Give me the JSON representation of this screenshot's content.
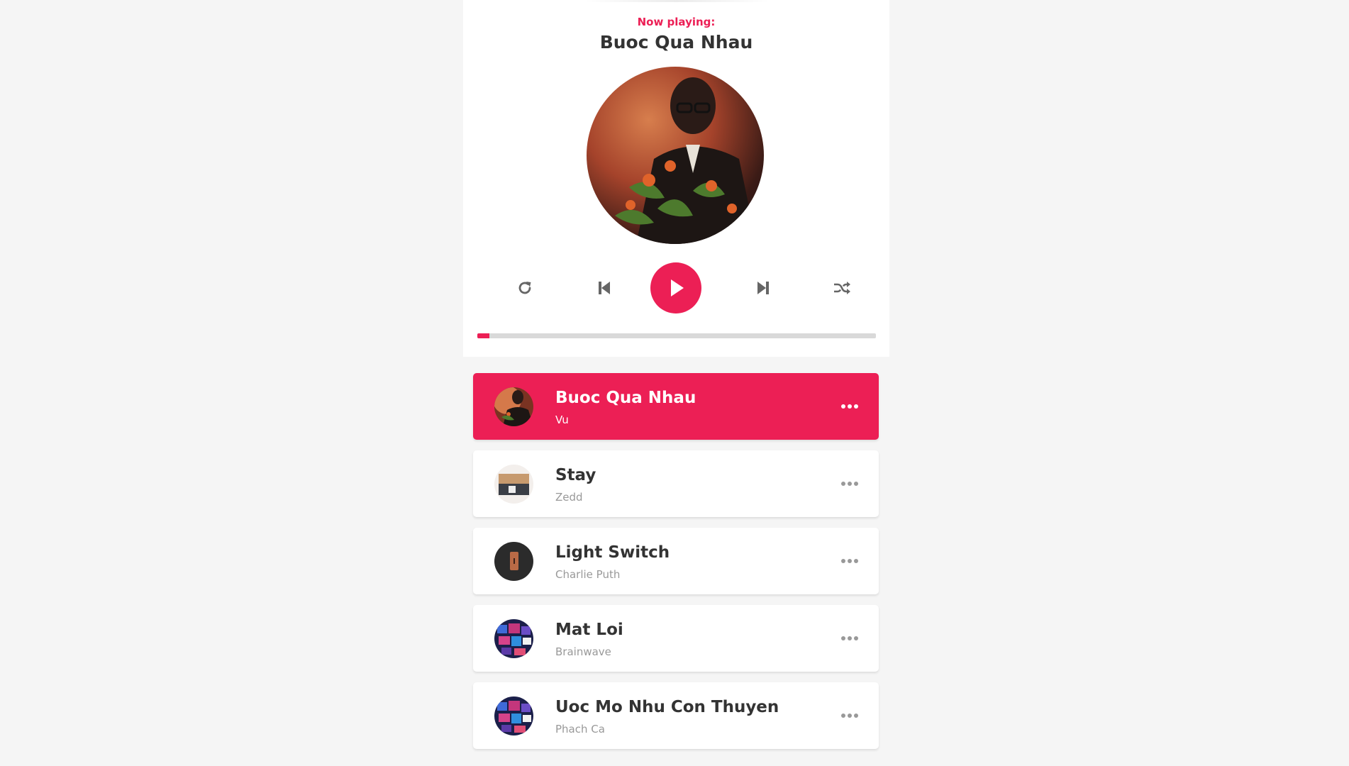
{
  "colors": {
    "accent": "#ec1f55",
    "text": "#333333",
    "muted": "#999999",
    "background": "#f5f5f5"
  },
  "player": {
    "now_playing_label": "Now playing:",
    "current_title": "Buoc Qua Nhau",
    "progress_percent": 3
  },
  "controls": {
    "repeat_icon": "repeat-icon",
    "prev_icon": "step-backward-icon",
    "play_icon": "play-icon",
    "next_icon": "step-forward-icon",
    "shuffle_icon": "shuffle-icon"
  },
  "playlist": [
    {
      "title": "Buoc Qua Nhau",
      "author": "Vu",
      "active": true
    },
    {
      "title": "Stay",
      "author": "Zedd",
      "active": false
    },
    {
      "title": "Light Switch",
      "author": "Charlie Puth",
      "active": false
    },
    {
      "title": "Mat Loi",
      "author": "Brainwave",
      "active": false
    },
    {
      "title": "Uoc Mo Nhu Con Thuyen",
      "author": "Phach Ca",
      "active": false
    }
  ]
}
